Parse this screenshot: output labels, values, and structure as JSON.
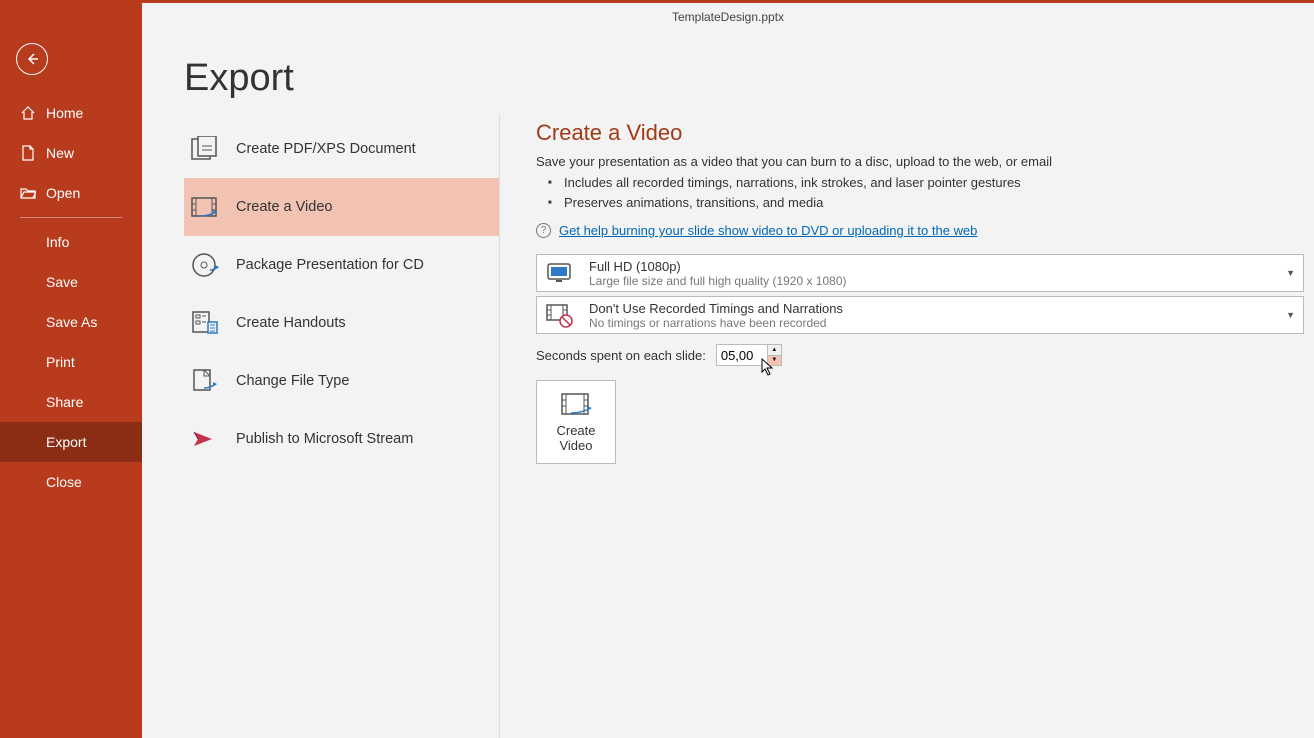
{
  "file_title": "TemplateDesign.pptx",
  "page_heading": "Export",
  "sidebar": {
    "home": "Home",
    "new": "New",
    "open": "Open",
    "info": "Info",
    "save": "Save",
    "save_as": "Save As",
    "print": "Print",
    "share": "Share",
    "export": "Export",
    "close": "Close"
  },
  "export_options": {
    "pdf": "Create PDF/XPS Document",
    "video": "Create a Video",
    "package": "Package Presentation for CD",
    "handouts": "Create Handouts",
    "filetype": "Change File Type",
    "stream": "Publish to Microsoft Stream"
  },
  "pane": {
    "title": "Create a Video",
    "desc": "Save your presentation as a video that you can burn to a disc, upload to the web, or email",
    "bullet1": "Includes all recorded timings, narrations, ink strokes, and laser pointer gestures",
    "bullet2": "Preserves animations, transitions, and media",
    "help_link": "Get help burning your slide show video to DVD or uploading it to the web",
    "quality_title": "Full HD (1080p)",
    "quality_sub": "Large file size and full high quality (1920 x 1080)",
    "timing_title": "Don't Use Recorded Timings and Narrations",
    "timing_sub": "No timings or narrations have been recorded",
    "seconds_label": "Seconds spent on each slide:",
    "seconds_value": "05,00",
    "create_label1": "Create",
    "create_label2": "Video"
  }
}
